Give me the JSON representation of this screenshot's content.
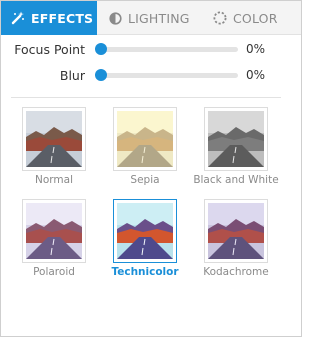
{
  "tabs": [
    {
      "label": "EFFECTS",
      "icon": "magic-wand-icon",
      "active": true
    },
    {
      "label": "LIGHTING",
      "icon": "half-circle-icon",
      "active": false
    },
    {
      "label": "COLOR",
      "icon": "dashed-circle-icon",
      "active": false
    }
  ],
  "sliders": [
    {
      "label": "Focus Point",
      "value": "0%",
      "level": 0
    },
    {
      "label": "Blur",
      "value": "0%",
      "level": 0
    }
  ],
  "filters": [
    {
      "label": "Normal",
      "selected": false
    },
    {
      "label": "Sepia",
      "selected": false
    },
    {
      "label": "Black and White",
      "selected": false
    },
    {
      "label": "Polaroid",
      "selected": false
    },
    {
      "label": "Technicolor",
      "selected": true
    },
    {
      "label": "Kodachrome",
      "selected": false
    }
  ],
  "colors": {
    "accent": "#1a8fd8",
    "inactive_text": "#8a8a8a"
  }
}
